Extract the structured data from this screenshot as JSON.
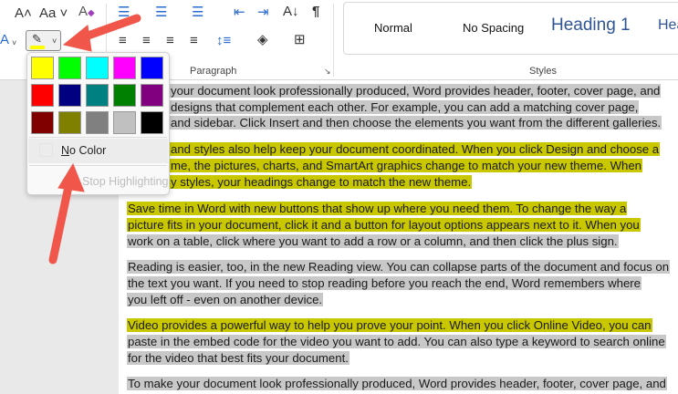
{
  "ribbon": {
    "font_group_label": "",
    "paragraph_label": "Paragraph",
    "styles_label": "Styles",
    "font_icons": [
      "grow-font-icon",
      "change-case-icon",
      "clear-formatting-icon",
      "font-color-icon",
      "highlight-icon"
    ],
    "paragraph_icons": [
      "bullets-icon",
      "numbering-icon",
      "multilevel-list-icon",
      "decrease-indent-icon",
      "increase-indent-icon",
      "sort-icon",
      "show-marks-icon",
      "align-left-icon",
      "center-icon",
      "align-right-icon",
      "justify-icon",
      "line-spacing-icon",
      "shading-icon",
      "borders-icon"
    ],
    "highlight_color": "#ffff00",
    "styles": [
      "Normal",
      "No Spacing",
      "Heading 1",
      "Hea"
    ]
  },
  "highlight_menu": {
    "colors": [
      "#ffff00",
      "#00ff00",
      "#00ffff",
      "#ff00ff",
      "#0000ff",
      "#ff0000",
      "#000080",
      "#008080",
      "#008000",
      "#800080",
      "#800000",
      "#808000",
      "#808080",
      "#c0c0c0",
      "#000000"
    ],
    "no_color_label": "No Color",
    "no_color_mnemonic": "N",
    "stop_label": "Stop Highlighting"
  },
  "document": {
    "lines": [
      {
        "text": "your document look professionally produced, Word provides header, footer, cover page, and",
        "hl": "g"
      },
      {
        "text": "designs that complement each other. For example, you can add a matching cover page,",
        "hl": "g"
      },
      {
        "text": "and sidebar. Click Insert and then choose the elements you want from the different galleries.",
        "hl": "g"
      },
      {
        "text": "and styles also help keep your document coordinated. When you click Design and choose a",
        "hl": "y"
      },
      {
        "text": "me, the pictures, charts, and SmartArt graphics change to match your new theme. When",
        "hl": "y"
      },
      {
        "text": "y styles, your headings change to match the new theme.",
        "hl": "y"
      },
      {
        "text": "Save time in Word with new buttons that show up where you need them. To change the way a",
        "hl": "y"
      },
      {
        "text": "picture fits in your document, click it and a button for layout options appears next to it. When you",
        "hl": "y"
      },
      {
        "text": "work on a table, click where you want to add a row or a column, and then click the plus sign.",
        "hl": "g"
      },
      {
        "text": "Reading is easier, too, in the new Reading view. You can collapse parts of the document and focus on",
        "hl": "g"
      },
      {
        "text": "the text you want. If you need to stop reading before you reach the end, Word remembers where",
        "hl": "g"
      },
      {
        "text": "you left off - even on another device.",
        "hl": "g"
      },
      {
        "text": "Video provides a powerful way to help you prove your point. When you click Online Video, you can",
        "hl": "y"
      },
      {
        "text": "paste in the embed code for the video you want to add. You can also type a keyword to search online",
        "hl": "g"
      },
      {
        "text": "for the video that best fits your document.",
        "hl": "g"
      },
      {
        "text": "To make your document look professionally produced, Word provides header, footer, cover page, and",
        "hl": "g"
      }
    ]
  },
  "accent": "#f0564a"
}
